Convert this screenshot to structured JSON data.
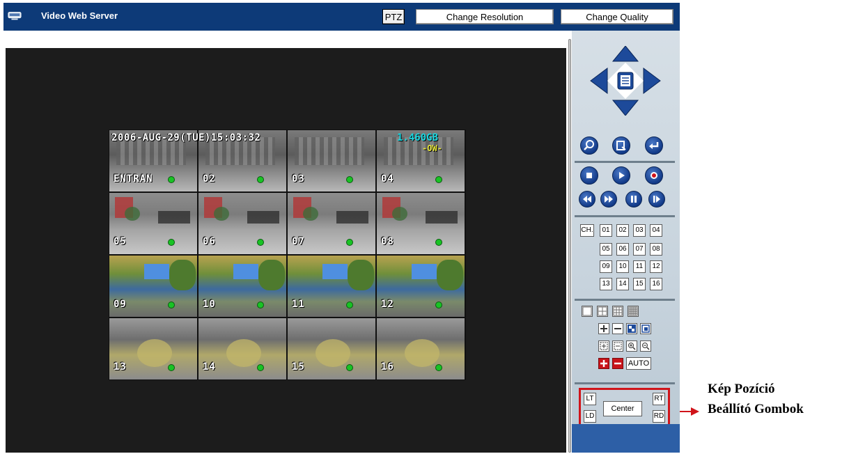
{
  "header": {
    "app_title": "Video Web Server",
    "ptz_label": "PTZ",
    "change_resolution_label": "Change Resolution",
    "change_quality_label": "Change Quality"
  },
  "osd": {
    "datetime": "2006-AUG-29(TUE)15:03:32",
    "hdd_capacity": "1.460GB",
    "overwrite": "-OW-"
  },
  "cameras": [
    {
      "label": "ENTRAN",
      "scene": "entrance"
    },
    {
      "label": "02",
      "scene": "entrance"
    },
    {
      "label": "03",
      "scene": "entrance"
    },
    {
      "label": "04",
      "scene": "entrance"
    },
    {
      "label": "05",
      "scene": "room"
    },
    {
      "label": "06",
      "scene": "room"
    },
    {
      "label": "07",
      "scene": "room"
    },
    {
      "label": "08",
      "scene": "room"
    },
    {
      "label": "09",
      "scene": "garden"
    },
    {
      "label": "10",
      "scene": "garden"
    },
    {
      "label": "11",
      "scene": "garden"
    },
    {
      "label": "12",
      "scene": "garden"
    },
    {
      "label": "13",
      "scene": "path"
    },
    {
      "label": "14",
      "scene": "path"
    },
    {
      "label": "15",
      "scene": "path"
    },
    {
      "label": "16",
      "scene": "path"
    }
  ],
  "panel": {
    "ch_label": "CH.",
    "channels": [
      "01",
      "02",
      "03",
      "04",
      "05",
      "06",
      "07",
      "08",
      "09",
      "10",
      "11",
      "12",
      "13",
      "14",
      "15",
      "16"
    ],
    "auto_label": "AUTO",
    "position": {
      "lt": "LT",
      "ld": "LD",
      "center": "Center",
      "rt": "RT",
      "rd": "RD"
    }
  },
  "annotation": {
    "line1": "Kép Pozíció",
    "line2": "Beállító Gombok",
    "color": "#d0141a"
  },
  "colors": {
    "titlebar": "#0d3a78",
    "status_dot": "#19c324",
    "highlight_border": "#d0141a"
  }
}
